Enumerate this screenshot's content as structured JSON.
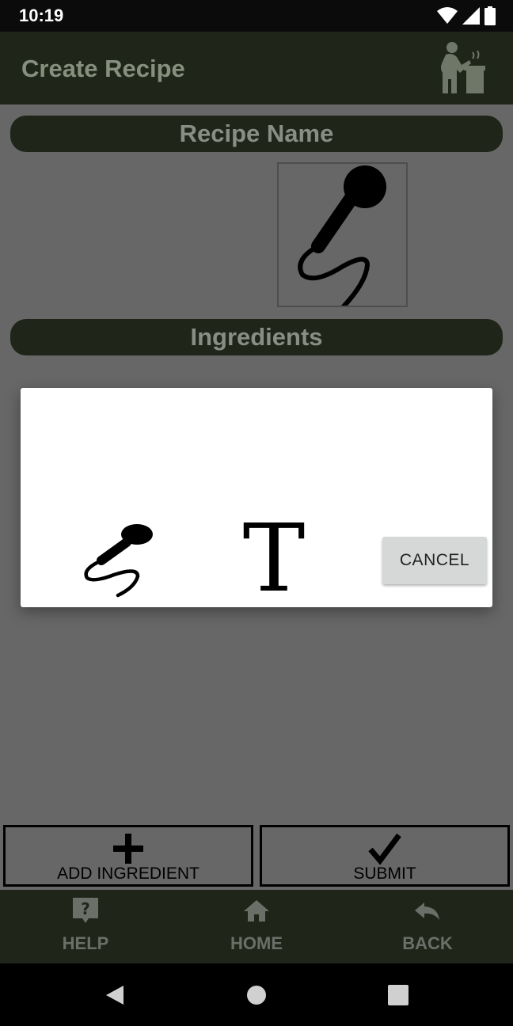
{
  "status_bar": {
    "time": "10:19",
    "icons": [
      "wifi-icon",
      "signal-icon",
      "battery-icon"
    ]
  },
  "app_bar": {
    "title": "Create Recipe",
    "logo_icon": "chef-cooking-icon"
  },
  "form": {
    "recipe_name_label": "Recipe Name",
    "voice_input_icon": "microphone-icon",
    "ingredients_label": "Ingredients"
  },
  "dialog": {
    "voice_option_icon": "microphone-icon",
    "text_option_glyph": "T",
    "cancel_label": "CANCEL"
  },
  "actions": {
    "add_ingredient_label": "ADD INGREDIENT",
    "submit_label": "SUBMIT"
  },
  "bottom_nav": {
    "help_label": "HELP",
    "home_label": "HOME",
    "back_label": "BACK"
  },
  "colors": {
    "app_bar": "#1f2619",
    "scrim_background": "#676767",
    "title_text": "#87907e",
    "dialog": "#ffffff",
    "cancel_button": "#d6d7d7"
  }
}
